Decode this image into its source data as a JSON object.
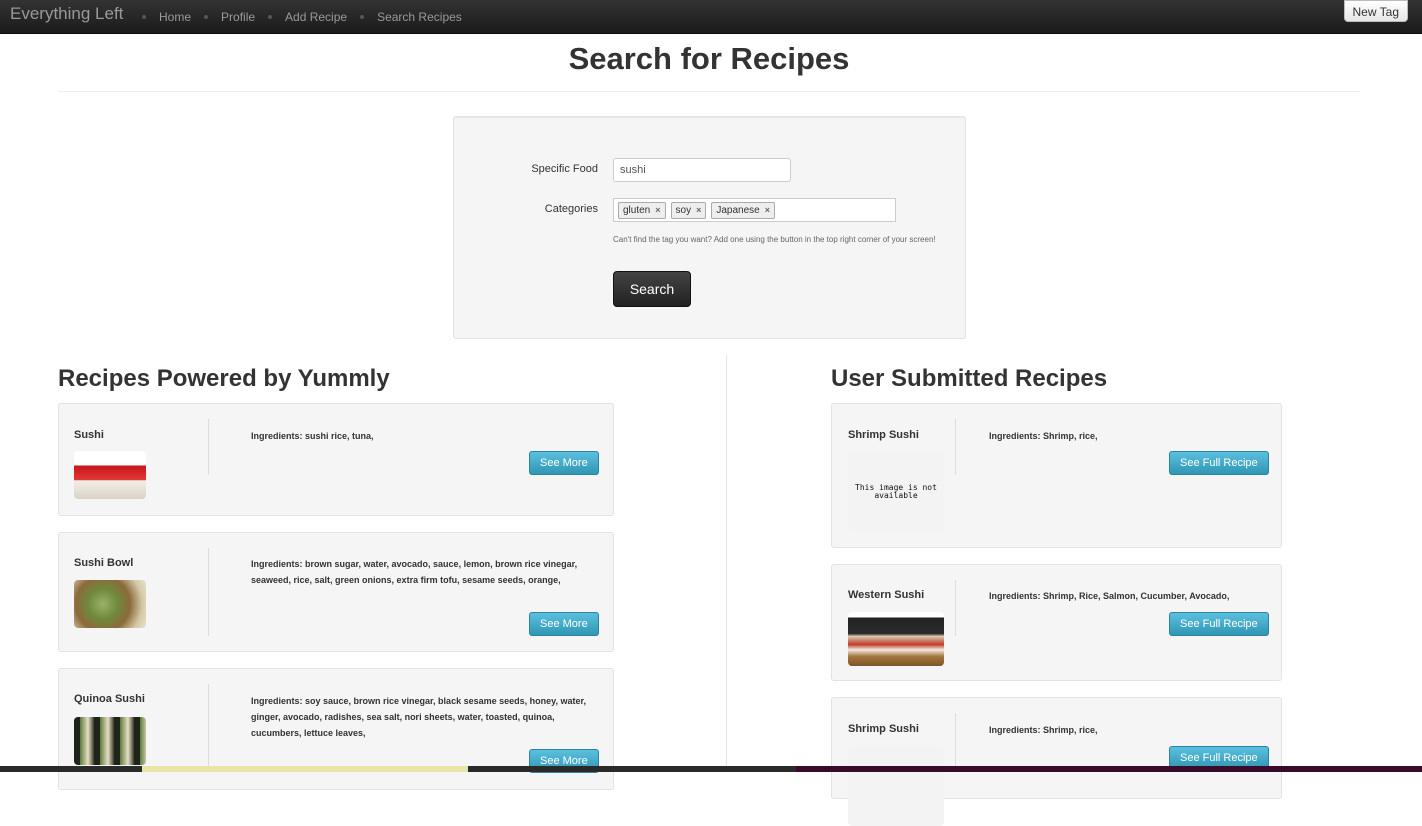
{
  "navbar": {
    "brand": "Everything Left",
    "links": [
      "Home",
      "Profile",
      "Add Recipe",
      "Search Recipes"
    ],
    "new_tag_label": "New Tag"
  },
  "page": {
    "title": "Search for Recipes"
  },
  "search_form": {
    "food_label": "Specific Food",
    "food_value": "sushi",
    "categories_label": "Categories",
    "tags": [
      "gluten",
      "soy",
      "Japanese"
    ],
    "tag_remove_glyph": "×",
    "help_text": "Can't find the tag you want? Add one using the button in the top right corner of your screen!",
    "search_label": "Search"
  },
  "yummly": {
    "title": "Recipes Powered by Yummly",
    "button_label": "See More",
    "recipes": [
      {
        "name": "Sushi",
        "ingredients": "Ingredients: sushi rice, tuna,"
      },
      {
        "name": "Sushi Bowl",
        "ingredients": "Ingredients: brown sugar, water, avocado, sauce, lemon, brown rice vinegar, seaweed, rice, salt, green onions, extra firm tofu, sesame seeds, orange,"
      },
      {
        "name": "Quinoa Sushi",
        "ingredients": "Ingredients: soy sauce, brown rice vinegar, black sesame seeds, honey, water, ginger, avocado, radishes, sea salt, nori sheets, water, toasted, quinoa, cucumbers, lettuce leaves,"
      }
    ]
  },
  "user_recipes": {
    "title": "User Submitted Recipes",
    "button_label": "See Full Recipe",
    "image_unavailable_text": "This image is not available",
    "recipes": [
      {
        "name": "Shrimp Sushi",
        "ingredients": "Ingredients: Shrimp, rice,"
      },
      {
        "name": "Western Sushi",
        "ingredients": "Ingredients: Shrimp, Rice, Salmon, Cucumber, Avocado,"
      },
      {
        "name": "Shrimp Sushi",
        "ingredients": "Ingredients: Shrimp, rice,"
      }
    ]
  }
}
